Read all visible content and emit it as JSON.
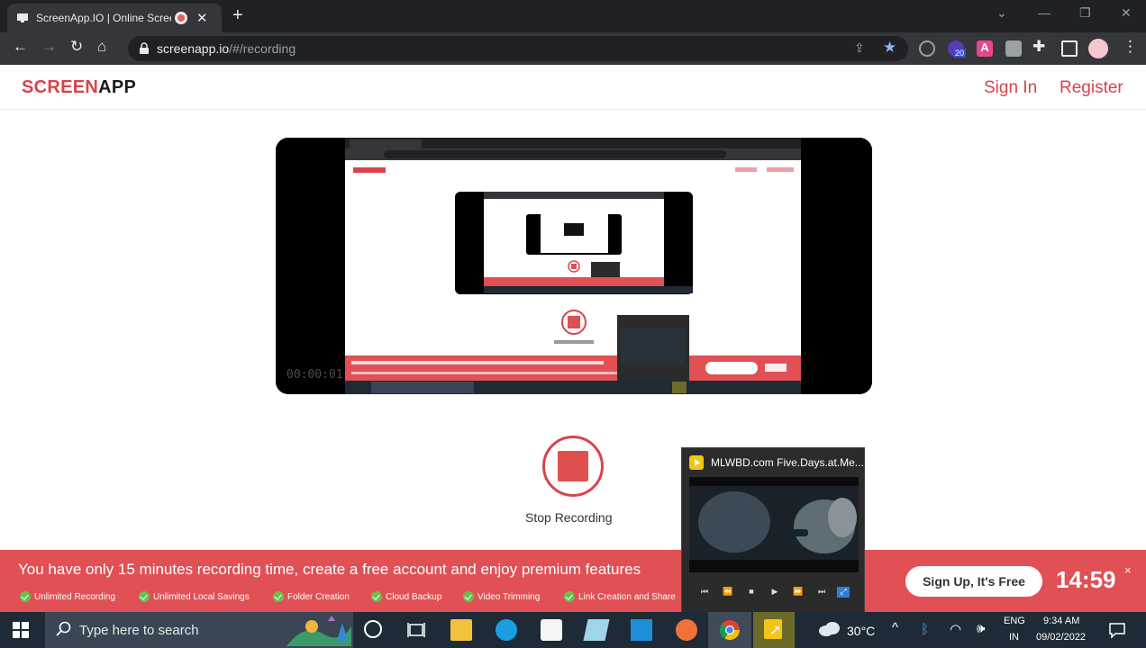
{
  "browser": {
    "tab_title": "ScreenApp.IO | Online Screen",
    "url_host": "screenapp.io",
    "url_path": "/#/recording",
    "extension_badge": "20"
  },
  "site": {
    "logo_part1": "SCREEN",
    "logo_part2": "APP",
    "sign_in": "Sign In",
    "register": "Register",
    "accent_color": "#d8444b"
  },
  "preview": {
    "timer": "00:00:01"
  },
  "recording": {
    "stop_label": "Stop Recording"
  },
  "banner": {
    "text": "You have only 15 minutes recording time, create a free account and enjoy premium features",
    "features": [
      "Unlimited Recording",
      "Unlimited Local Savings",
      "Folder Creation",
      "Cloud Backup",
      "Video Trimming",
      "Link Creation and Share"
    ],
    "signup_label": "Sign Up, It's Free",
    "timer": "14:59",
    "close": "×"
  },
  "mini_player": {
    "title": "MLWBD.com Five.Days.at.Me..."
  },
  "taskbar": {
    "search_placeholder": "Type here to search",
    "temperature": "30°C",
    "lang_line1": "ENG",
    "lang_line2": "IN",
    "time": "9:34 AM",
    "date": "09/02/2022"
  }
}
